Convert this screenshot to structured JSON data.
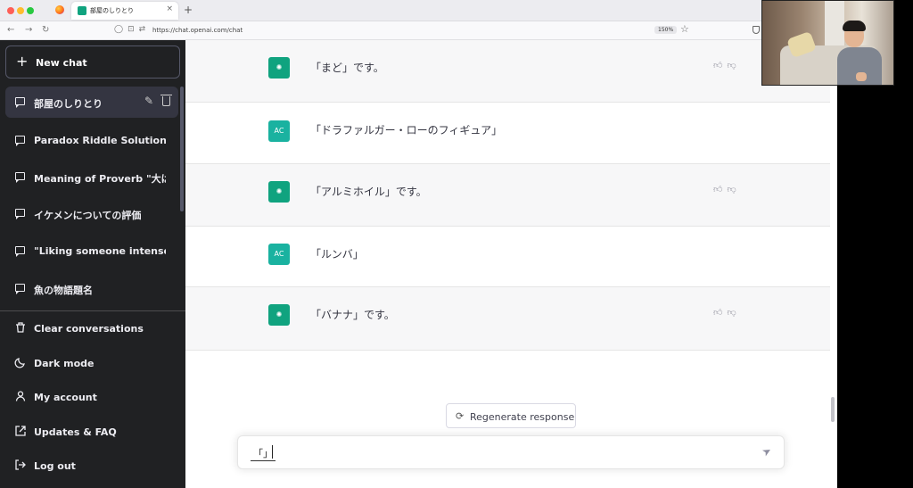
{
  "browser": {
    "tab_title": "部屋のしりとり",
    "tab_close": "×",
    "new_tab": "+",
    "url": "https://chat.openai.com/chat",
    "zoom": "150%",
    "back": "←",
    "forward": "→",
    "reload": "↻"
  },
  "sidebar": {
    "new_chat_label": "New chat",
    "conversations": [
      {
        "title": "部屋のしりとり",
        "active": true
      },
      {
        "title": "Paradox Riddle Solution"
      },
      {
        "title": "Meaning of Proverb \"大は小"
      },
      {
        "title": "イケメンについての評価"
      },
      {
        "title": "\"Liking someone intensely\""
      },
      {
        "title": "魚の物語題名"
      }
    ],
    "menu": [
      {
        "label": "Clear conversations",
        "icon": "trash-icon"
      },
      {
        "label": "Dark mode",
        "icon": "moon-icon"
      },
      {
        "label": "My account",
        "icon": "user-icon"
      },
      {
        "label": "Updates & FAQ",
        "icon": "external-link-icon"
      },
      {
        "label": "Log out",
        "icon": "logout-icon"
      }
    ]
  },
  "chat": {
    "messages": [
      {
        "role": "assistant",
        "text": "「まど」です。"
      },
      {
        "role": "user",
        "avatar": "AC",
        "text": "「ドラファルガー・ローのフィギュア」"
      },
      {
        "role": "assistant",
        "text": "「アルミホイル」です。"
      },
      {
        "role": "user",
        "avatar": "AC",
        "text": "「ルンバ」"
      },
      {
        "role": "assistant",
        "text": "「バナナ」です。"
      }
    ],
    "regenerate_label": "Regenerate response",
    "input_value": "「」"
  },
  "colors": {
    "sidebar_bg": "#202123",
    "assistant_avatar": "#10a37f",
    "user_avatar": "#1ab2a0"
  }
}
